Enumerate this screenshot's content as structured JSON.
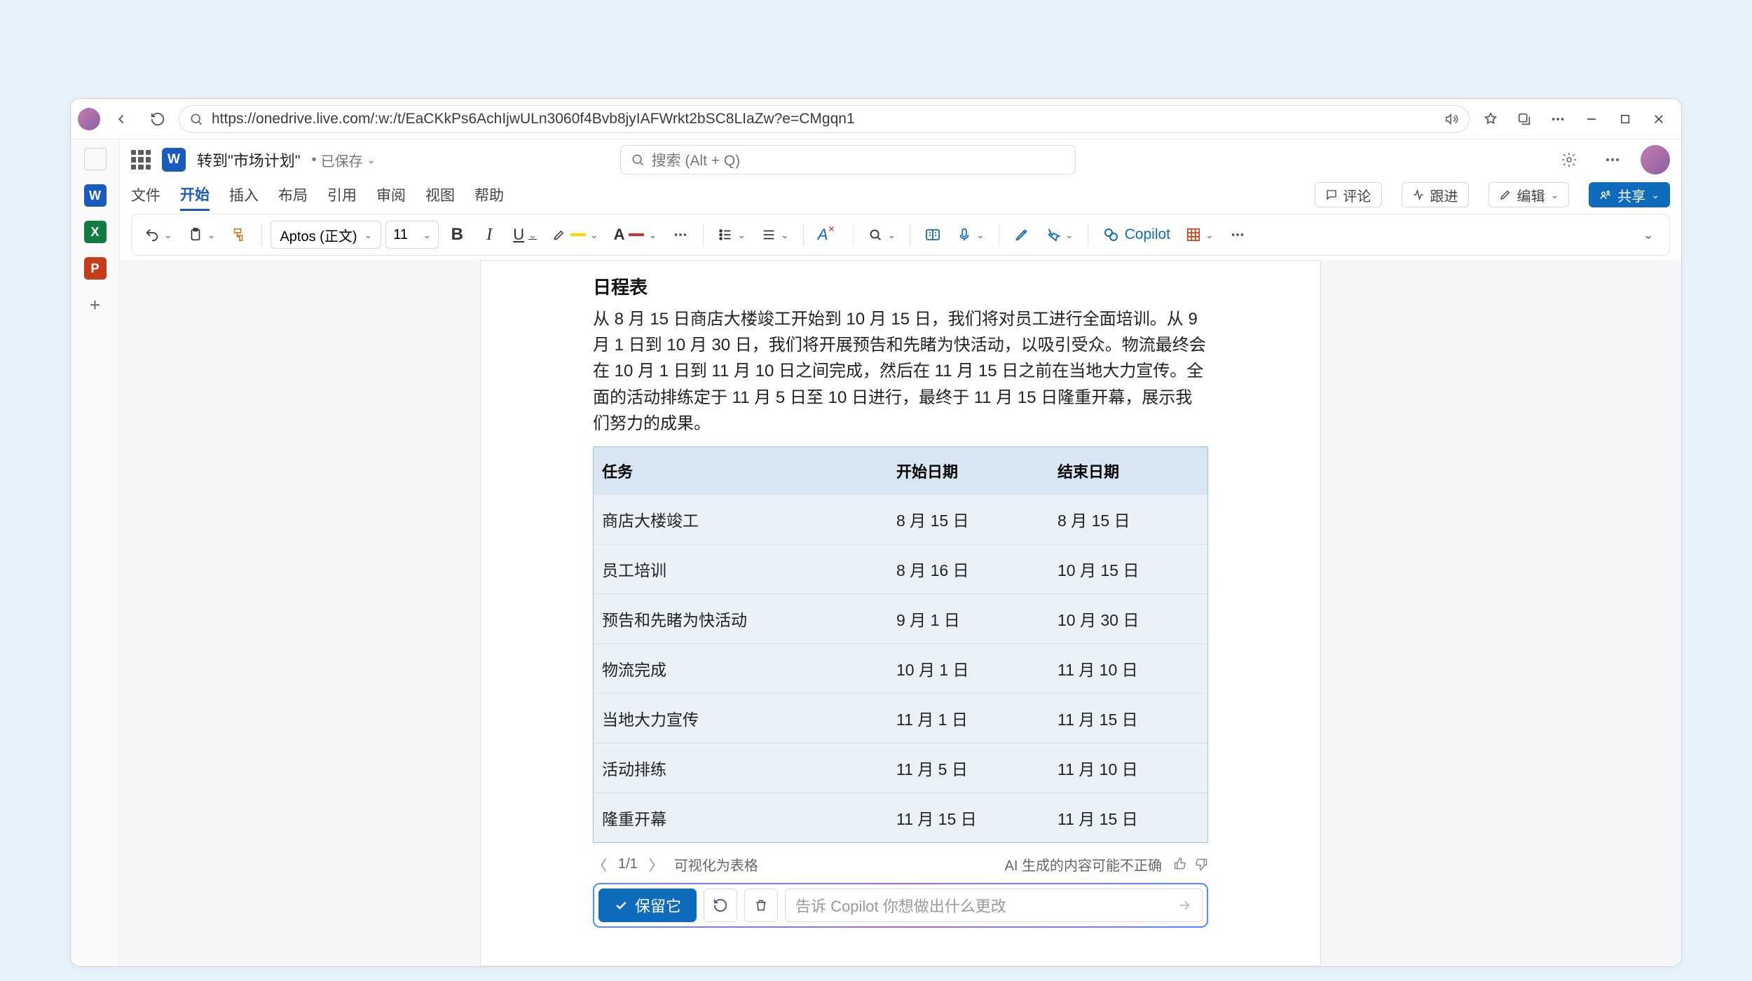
{
  "browser": {
    "url": "https://onedrive.live.com/:w:/t/EaCKkPs6AchIjwULn3060f4Bvb8jyIAFWrkt2bSC8LIaZw?e=CMgqn1"
  },
  "rail": {
    "word": "W",
    "excel": "X",
    "ppt": "P",
    "add": "+"
  },
  "title": {
    "app_glyph": "W",
    "doc_name": "转到\"市场计划\"",
    "saved": "已保存",
    "search_placeholder": "搜索 (Alt + Q)"
  },
  "menu": {
    "items": [
      "文件",
      "开始",
      "插入",
      "布局",
      "引用",
      "审阅",
      "视图",
      "帮助"
    ],
    "active_index": 1,
    "comments": "评论",
    "catchup": "跟进",
    "edit": "编辑",
    "share": "共享"
  },
  "ribbon": {
    "font": "Aptos  (正文)",
    "size": "11",
    "copilot": "Copilot"
  },
  "doc": {
    "heading": "日程表",
    "paragraph": "从 8 月 15 日商店大楼竣工开始到 10 月 15 日，我们将对员工进行全面培训。从 9 月 1 日到 10 月 30 日，我们将开展预告和先睹为快活动，以吸引受众。物流最终会在 10 月 1 日到 11 月 10 日之间完成，然后在 11 月 15 日之前在当地大力宣传。全面的活动排练定于 11 月 5 日至 10 日进行，最终于 11 月 15 日隆重开幕，展示我们努力的成果。",
    "table": {
      "headers": [
        "任务",
        "开始日期",
        "结束日期"
      ],
      "rows": [
        [
          "商店大楼竣工",
          "8 月 15 日",
          "8 月 15 日"
        ],
        [
          "员工培训",
          "8 月 16 日",
          "10 月 15 日"
        ],
        [
          "预告和先睹为快活动",
          "9 月 1 日",
          "10 月 30 日"
        ],
        [
          "物流完成",
          "10 月 1 日",
          "11 月 10 日"
        ],
        [
          "当地大力宣传",
          "11 月 1 日",
          "11 月 15 日"
        ],
        [
          "活动排练",
          "11 月 5 日",
          "11 月 10 日"
        ],
        [
          "隆重开幕",
          "11 月 15 日",
          "11 月 15 日"
        ]
      ]
    }
  },
  "copilot": {
    "counter": "1/1",
    "action_label": "可视化为表格",
    "disclaimer": "AI 生成的内容可能不正确",
    "keep": "保留它",
    "placeholder": "告诉 Copilot 你想做出什么更改"
  }
}
